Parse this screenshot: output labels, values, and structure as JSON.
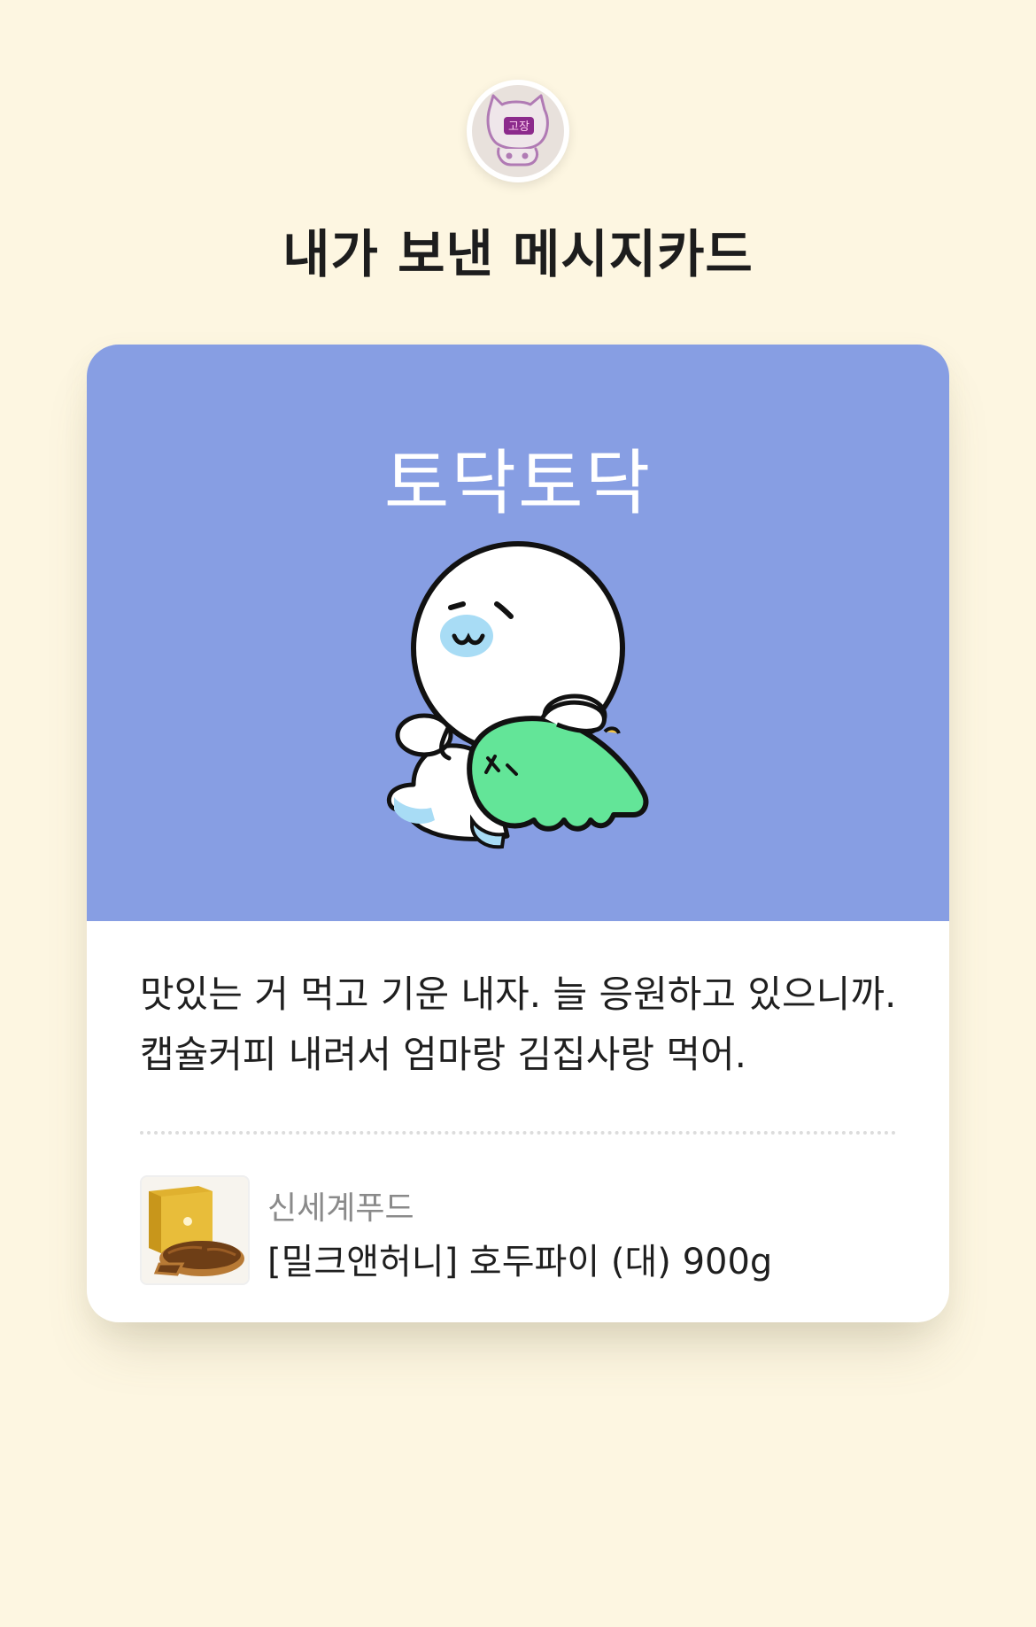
{
  "header": {
    "avatar_label": "고장",
    "title": "내가 보낸 메시지카드"
  },
  "card": {
    "banner_text": "토닥토닥",
    "message": "맛있는 거 먹고 기운 내자. 늘 응원하고 있으니까.\n캡슐커피 내려서 엄마랑 김집사랑 먹어.",
    "product": {
      "brand": "신세계푸드",
      "name": "[밀크앤허니] 호두파이 (대) 900g"
    }
  },
  "colors": {
    "background": "#fdf6e1",
    "banner": "#879ee3",
    "sticker_green": "#63e598",
    "sticker_blue": "#a8dcf5"
  },
  "icons": {
    "avatar": "cat-avatar-icon",
    "sticker": "hug-sticker-icon",
    "product": "pecan-pie-thumbnail"
  }
}
